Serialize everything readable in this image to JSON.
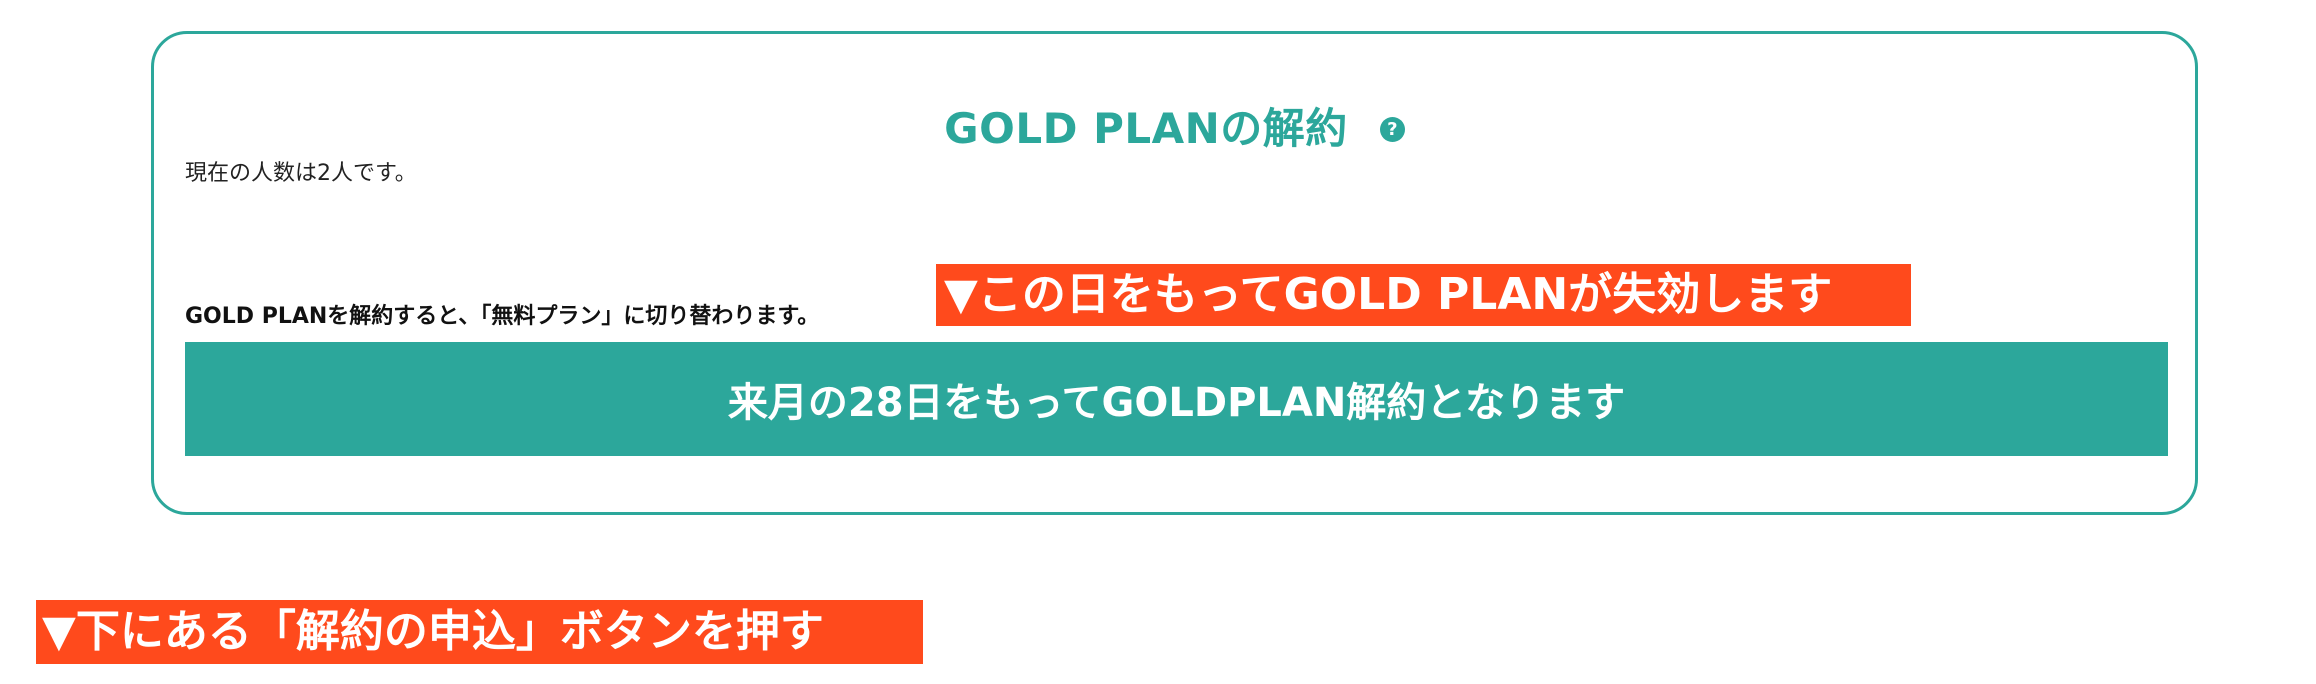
{
  "plan_card": {
    "title": "GOLD PLANの解約",
    "help_icon_glyph": "?",
    "member_count_text": "現在の人数は2人です。",
    "notice_text": "GOLD PLANを解約すると、「無料プラン」に切り替わります。",
    "cancel_date_text": "来月の28日をもってGOLDPLAN解約となります"
  },
  "annotations": {
    "top": "▼この日をもってGOLD PLANが失効します",
    "bottom": "▼下にある「解約の申込」ボタンを押す"
  },
  "colors": {
    "accent": "#2ca79b",
    "annotation": "#ff4a1c"
  }
}
